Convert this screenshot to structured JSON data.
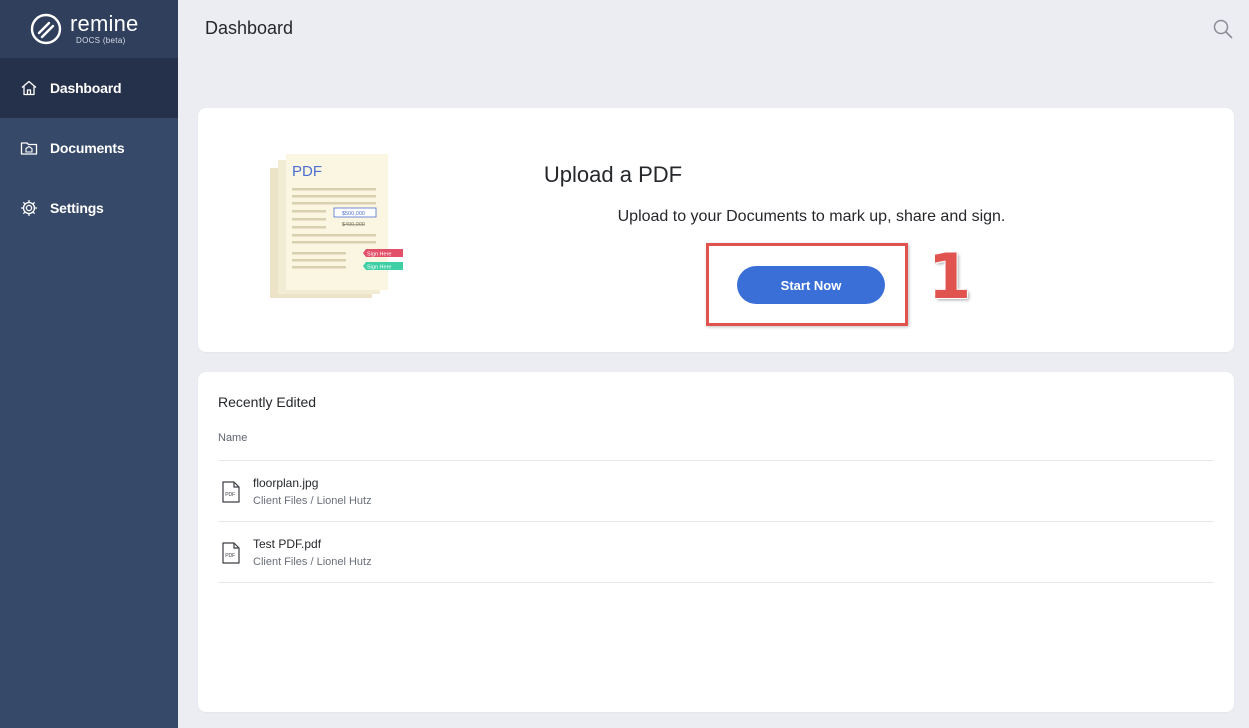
{
  "brand": {
    "name": "remine",
    "subtitle": "DOCS (beta)"
  },
  "sidebar": {
    "items": [
      {
        "label": "Dashboard",
        "icon": "home-icon",
        "active": true
      },
      {
        "label": "Documents",
        "icon": "folder-icon",
        "active": false
      },
      {
        "label": "Settings",
        "icon": "gear-icon",
        "active": false
      }
    ]
  },
  "header": {
    "title": "Dashboard",
    "search_icon": "search-icon"
  },
  "upload": {
    "title": "Upload a PDF",
    "subtitle": "Upload to your Documents to mark up, share and sign.",
    "button_label": "Start Now",
    "annotation_number": "1",
    "illustration": {
      "label": "PDF",
      "amount_new": "$500,000",
      "amount_old": "$400,000",
      "sign_label_1": "Sign Here",
      "sign_label_2": "Sign Here"
    }
  },
  "recent": {
    "title": "Recently Edited",
    "column_name": "Name",
    "files": [
      {
        "name": "floorplan.jpg",
        "path": "Client Files / Lionel Hutz",
        "icon": "pdf-file-icon"
      },
      {
        "name": "Test PDF.pdf",
        "path": "Client Files / Lionel Hutz",
        "icon": "pdf-file-icon"
      }
    ]
  },
  "colors": {
    "sidebar_bg": "#374968",
    "sidebar_active": "#25304a",
    "accent_button": "#3b6fd8",
    "annotation_red": "#e0534e",
    "page_bg": "#ecedf2"
  }
}
